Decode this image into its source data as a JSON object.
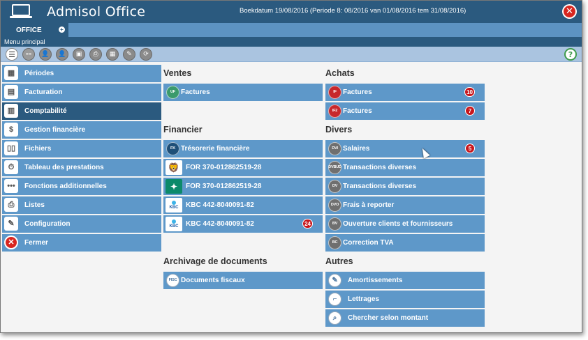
{
  "window": {
    "title": "Admisol Office",
    "period_info": "Boekdatum 19/08/2016 (Periode 8: 08/2016 van 01/08/2016 tem 31/08/2016)",
    "close_icon": "close-icon",
    "logo_icon": "laptop-icon"
  },
  "tabs": [
    {
      "label": "OFFICE"
    }
  ],
  "menu_label": "Menu principal",
  "toolbar": {
    "icons": [
      "list-icon",
      "calendar-text-icon",
      "user-add-icon",
      "user-manage-icon",
      "box-icon",
      "printer-icon",
      "calculator-icon",
      "wrench-icon",
      "refresh-icon"
    ],
    "help_icon": "help-icon"
  },
  "sidebar": {
    "items": [
      {
        "label": "Périodes",
        "icon": "calendar-icon",
        "active": false
      },
      {
        "label": "Facturation",
        "icon": "invoice-icon",
        "active": false
      },
      {
        "label": "Comptabilité",
        "icon": "ledger-icon",
        "active": true
      },
      {
        "label": "Gestion financière",
        "icon": "finance-icon",
        "active": false
      },
      {
        "label": "Fichiers",
        "icon": "files-icon",
        "active": false
      },
      {
        "label": "Tableau des prestations",
        "icon": "stopwatch-icon",
        "active": false
      },
      {
        "label": "Fonctions additionnelles",
        "icon": "more-icon",
        "active": false
      },
      {
        "label": "Listes",
        "icon": "printer-icon",
        "active": false
      },
      {
        "label": "Configuration",
        "icon": "wrench-icon",
        "active": false
      },
      {
        "label": "Fermer",
        "icon": "close-icon",
        "active": false
      }
    ]
  },
  "sections": {
    "ventes": {
      "title": "Ventes",
      "items": [
        {
          "label": "Factures",
          "code": "UF",
          "badge": ""
        }
      ]
    },
    "achats": {
      "title": "Achats",
      "items": [
        {
          "label": "Factures",
          "code": "IF",
          "badge": "10"
        },
        {
          "label": "Factures",
          "code": "IF2",
          "badge": "7"
        }
      ]
    },
    "financier": {
      "title": "Financier",
      "items": [
        {
          "label": "Trésorerie financière",
          "code": "FK",
          "badge": ""
        },
        {
          "label": "FOR 370-012862519-28",
          "bank": "ing-lion-icon",
          "badge": ""
        },
        {
          "label": "FOR 370-012862519-28",
          "bank": "bnp-stars-icon",
          "badge": ""
        },
        {
          "label": "KBC 442-8040091-82",
          "bank": "kbc-logo-icon",
          "bank_text": "KBC",
          "badge": ""
        },
        {
          "label": "KBC 442-8040091-82",
          "bank": "kbc-logo-icon",
          "bank_text": "KBC",
          "badge": "24"
        }
      ]
    },
    "divers": {
      "title": "Divers",
      "items": [
        {
          "label": "Salaires",
          "code": "DVI",
          "badge": "5"
        },
        {
          "label": "Transactions diverses",
          "code": "DVBUD",
          "badge": ""
        },
        {
          "label": "Transactions diverses",
          "code": "DV",
          "badge": ""
        },
        {
          "label": "Frais à reporter",
          "code": "DVO",
          "badge": ""
        },
        {
          "label": "Ouverture clients et fournisseurs",
          "code": "BV",
          "badge": ""
        },
        {
          "label": "Correction TVA",
          "code": "BC",
          "badge": ""
        }
      ]
    },
    "archivage": {
      "title": "Archivage de documents",
      "items": [
        {
          "label": "Documents fiscaux",
          "code": "FISC",
          "badge": ""
        }
      ]
    },
    "autres": {
      "title": "Autres",
      "items": [
        {
          "label": "Amortissements",
          "icon": "edit-icon"
        },
        {
          "label": "Lettrages",
          "icon": "link-icon"
        },
        {
          "label": "Chercher selon montant",
          "icon": "search-icon"
        }
      ]
    }
  },
  "colors": {
    "header": "#2b5a7f",
    "button": "#5e98c9",
    "badge": "#c7161c"
  }
}
